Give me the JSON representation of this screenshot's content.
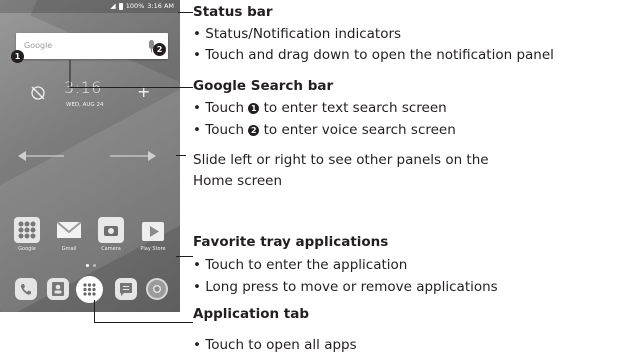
{
  "phone": {
    "status_time": "3:16 AM",
    "status_battery": "100%",
    "search_logo": "Google",
    "marker_1": "1",
    "marker_2": "2",
    "clock": "3:16",
    "date": "WED, AUG 24",
    "apps": [
      {
        "label": "Google",
        "icon": "google-folder-icon"
      },
      {
        "label": "Gmail",
        "icon": "gmail-icon"
      },
      {
        "label": "Camera",
        "icon": "camera-icon"
      },
      {
        "label": "Play Store",
        "icon": "play-store-icon"
      }
    ],
    "dock": [
      "phone-icon",
      "contacts-icon",
      "apps-grid-icon",
      "messages-icon",
      "chrome-icon"
    ]
  },
  "sections": {
    "status_bar": {
      "title": "Status bar",
      "bullets": [
        "Status/Notification indicators",
        "Touch and drag down to open the notification panel"
      ]
    },
    "search_bar": {
      "title": "Google Search bar",
      "bullet_1_pre": "Touch ",
      "bullet_1_num": "1",
      "bullet_1_post": " to enter text search screen",
      "bullet_2_pre": "Touch ",
      "bullet_2_num": "2",
      "bullet_2_post": " to enter voice search screen"
    },
    "slide": {
      "line1": "Slide left or right to see other panels on the",
      "line2": "Home screen"
    },
    "favorite_tray": {
      "title": "Favorite tray applications",
      "bullets": [
        "Touch to enter the application",
        "Long press to move or remove applications"
      ]
    },
    "app_tab": {
      "title": "Application tab",
      "bullets": [
        "Touch to open all apps"
      ]
    }
  }
}
